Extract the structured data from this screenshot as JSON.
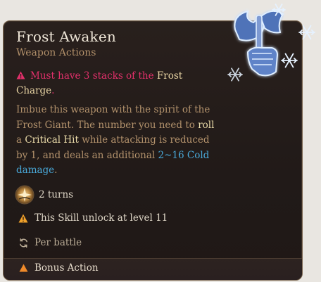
{
  "tooltip": {
    "title": "Frost Awaken",
    "subtitle": "Weapon Actions",
    "requirement": {
      "prefix": "Must have 3 stacks of the ",
      "highlight": "Frost Charge",
      "suffix": "."
    },
    "description": {
      "part1": "Imbue this weapon with the spirit of the Frost Giant. The number you need to ",
      "roll": "roll",
      "part2": " a ",
      "crit": "Critical Hit",
      "part3": " while attacking is reduced by 1, and deals an additional ",
      "damage": "2~16 Cold damage",
      "part4": "."
    },
    "duration": "2 turns",
    "unlock": "This Skill unlock at level 11",
    "recharge": "Per battle",
    "action_type": "Bonus Action"
  },
  "colors": {
    "requirement": "#e0306a",
    "highlight": "#eadba9",
    "damage": "#49a8d8",
    "description": "#b3926c",
    "warning_icon": "#f0a12a"
  },
  "icons": {
    "requirement": "warning-triangle-icon",
    "duration": "turns-duration-icon",
    "unlock": "warning-triangle-icon",
    "recharge": "refresh-cycle-icon",
    "action": "bonus-action-triangle-icon",
    "art": "frost-axe-fist-icon"
  }
}
